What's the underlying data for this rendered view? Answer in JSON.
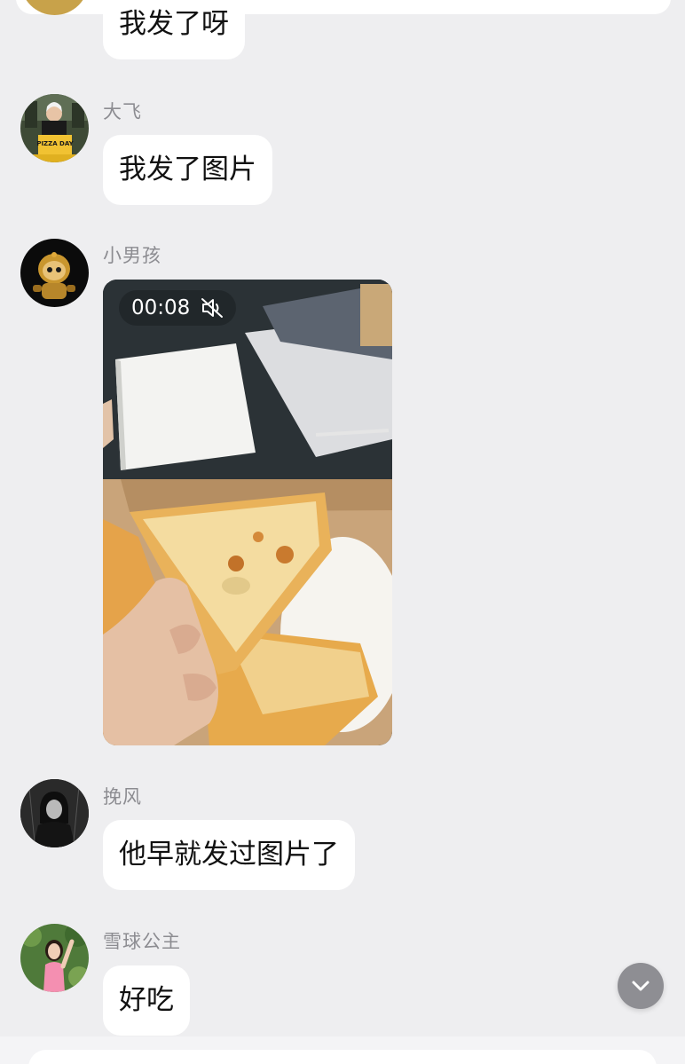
{
  "messages": [
    {
      "text": "我发了呀"
    },
    {
      "sender": "大飞",
      "text": "我发了图片"
    },
    {
      "sender": "小男孩",
      "video": {
        "duration": "00:08",
        "muted": true
      }
    },
    {
      "sender": "挽风",
      "text": "他早就发过图片了"
    },
    {
      "sender": "雪球公主",
      "text": "好吃"
    }
  ],
  "avatar_texts": {
    "pizza_day": "PIZZA DAY"
  },
  "icons": {
    "mute": "speaker-muted-icon",
    "scroll_down": "chevron-down-icon"
  },
  "colors": {
    "background": "#eeeef0",
    "bubble": "#ffffff",
    "sender_name": "#8c8c91",
    "scroll_button": "#8e8e93"
  }
}
